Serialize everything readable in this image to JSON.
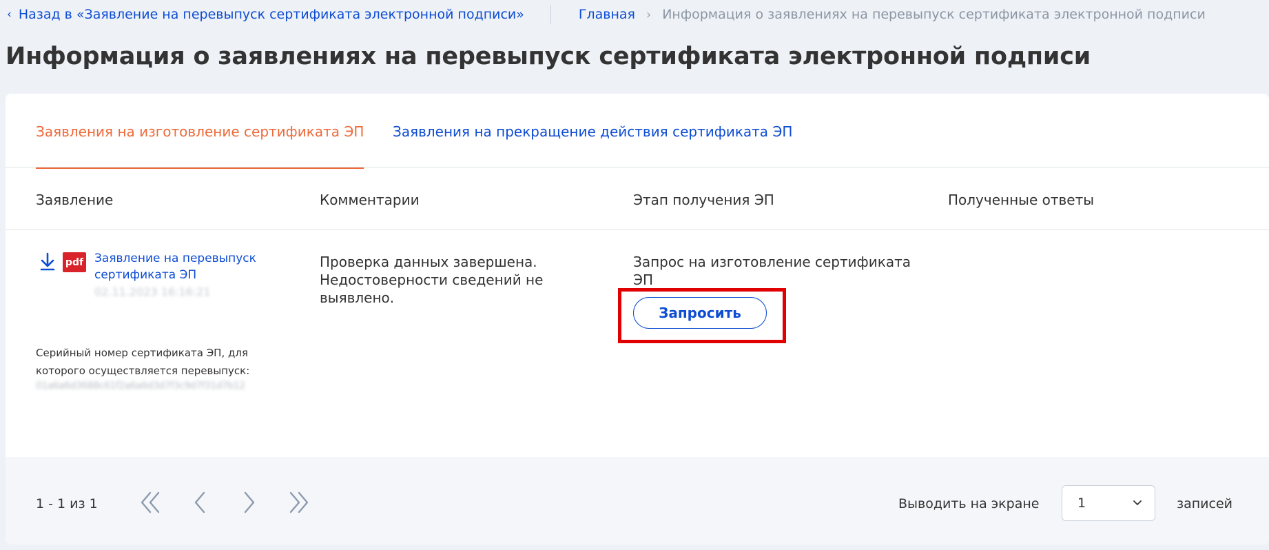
{
  "topbar": {
    "back_label": "Назад в «Заявление на перевыпуск сертификата электронной подписи»",
    "crumb_home": "Главная",
    "crumb_current": "Информация о заявлениях на перевыпуск сертификата электронной подписи"
  },
  "page_title": "Информация о заявлениях на перевыпуск сертификата электронной подписи",
  "tabs": [
    {
      "label": "Заявления на изготовление сертификата ЭП",
      "active": true
    },
    {
      "label": "Заявления на прекращение действия сертификата ЭП",
      "active": false
    }
  ],
  "table": {
    "headers": [
      "Заявление",
      "Комментарии",
      "Этап получения ЭП",
      "Полученные ответы"
    ],
    "rows": [
      {
        "doc_title": "Заявление на перевыпуск сертификата ЭП",
        "doc_badge": "pdf",
        "doc_date": "02.11.2023 16:16:21",
        "serial_label": "Серийный номер сертификата ЭП, для которого осуществляется перевыпуск:",
        "serial_value": "01a6a6d3688c61f2a6a6d3d7f3c9d7f31d7b12",
        "comment": "Проверка данных завершена. Недостоверности сведений не выявлено.",
        "stage": "Запрос на изготовление сертификата ЭП",
        "action_label": "Запросить",
        "responses": ""
      }
    ]
  },
  "pagination": {
    "info": "1 - 1 из 1",
    "show_label": "Выводить на экране",
    "per_page_value": "1",
    "records_label": "записей"
  },
  "colors": {
    "link": "#0d4cd3",
    "active_tab": "#ee6a3a",
    "highlight": "#e00000",
    "pdf": "#d8232a"
  }
}
